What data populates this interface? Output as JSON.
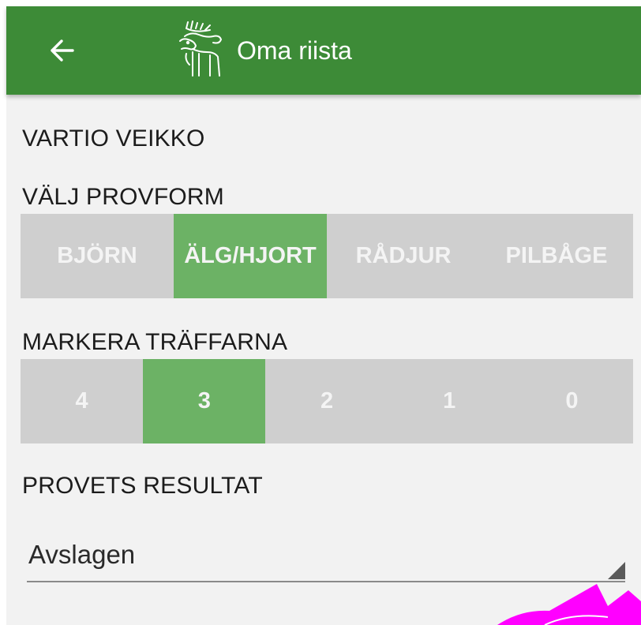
{
  "toolbar": {
    "title": "Oma riista",
    "back_icon": "arrow-left-icon",
    "logo_icon": "moose-logo-icon",
    "background_color": "#3d8b37"
  },
  "person": {
    "name": "VARTIO VEIKKO"
  },
  "test_type": {
    "label": "VÄLJ PROVFORM",
    "options": [
      "BJÖRN",
      "ÄLG/HJORT",
      "RÅDJUR",
      "PILBÅGE"
    ],
    "selected": "ÄLG/HJORT"
  },
  "hits": {
    "label": "MARKERA TRÄFFARNA",
    "options": [
      "4",
      "3",
      "2",
      "1",
      "0"
    ],
    "selected": "3"
  },
  "result": {
    "label": "PROVETS RESULTAT",
    "value": "Avslagen"
  },
  "colors": {
    "selected": "#6cb265",
    "unselected": "#cfcfcf",
    "background": "#f2f2f2"
  }
}
